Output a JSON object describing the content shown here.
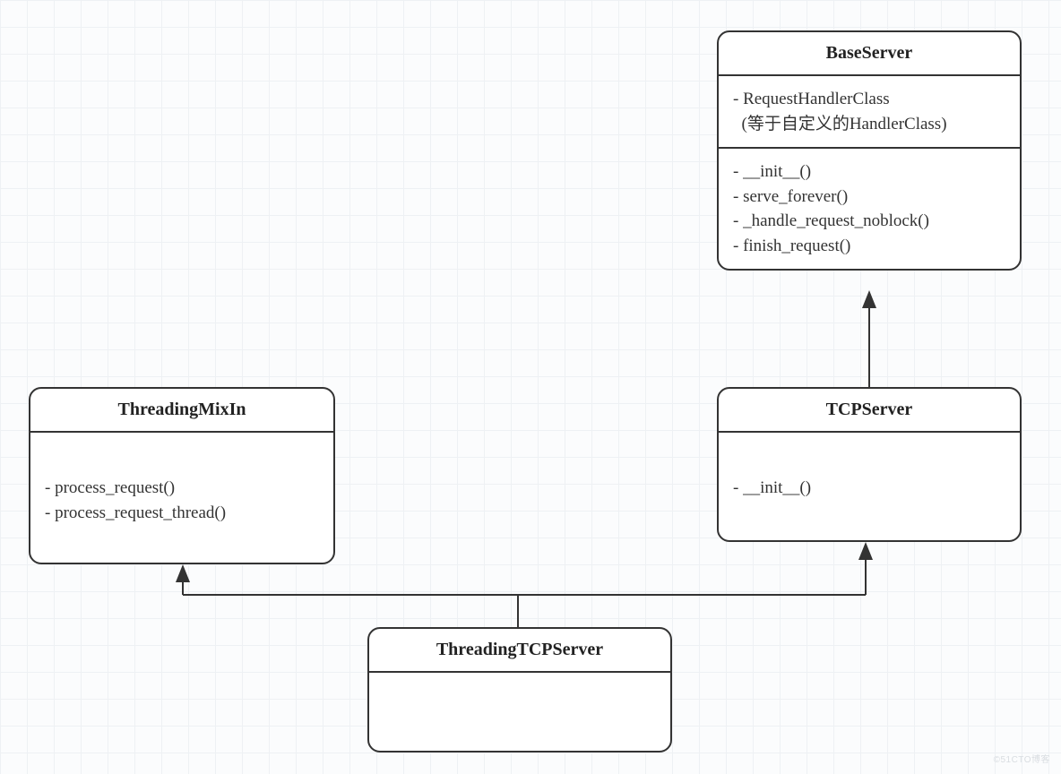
{
  "diagram": {
    "classes": {
      "base_server": {
        "name": "BaseServer",
        "attributes": [
          "- RequestHandlerClass",
          "  (等于自定义的HandlerClass)"
        ],
        "methods": [
          "- __init__()",
          "- serve_forever()",
          "- _handle_request_noblock()",
          "- finish_request()"
        ]
      },
      "threading_mixin": {
        "name": "ThreadingMixIn",
        "methods": [
          "- process_request()",
          "- process_request_thread()"
        ]
      },
      "tcp_server": {
        "name": "TCPServer",
        "methods": [
          "- __init__()"
        ]
      },
      "threading_tcp_server": {
        "name": "ThreadingTCPServer"
      }
    },
    "relationships": [
      {
        "from": "TCPServer",
        "to": "BaseServer",
        "type": "inherits"
      },
      {
        "from": "ThreadingTCPServer",
        "to": "ThreadingMixIn",
        "type": "inherits"
      },
      {
        "from": "ThreadingTCPServer",
        "to": "TCPServer",
        "type": "inherits"
      }
    ],
    "watermark": "©51CTO博客"
  }
}
